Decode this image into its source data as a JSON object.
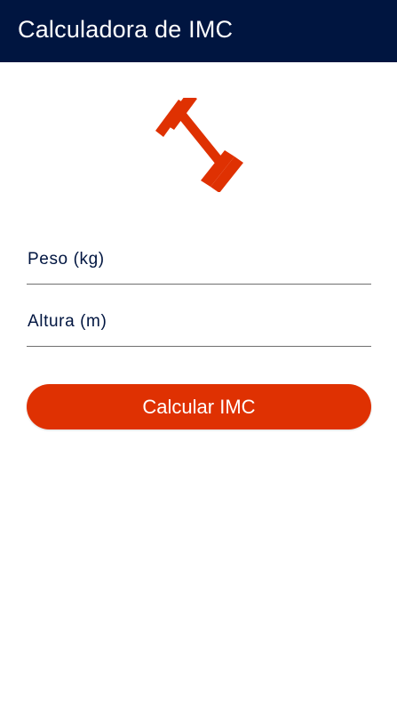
{
  "app_bar": {
    "title": "Calculadora de IMC",
    "background": "#001540"
  },
  "logo": {
    "icon": "dumbbell-icon",
    "color": "#df3102"
  },
  "form": {
    "weight": {
      "placeholder": "Peso (kg)",
      "value": ""
    },
    "height": {
      "placeholder": "Altura (m)",
      "value": ""
    },
    "submit_label": "Calcular IMC",
    "accent": "#df3102"
  }
}
